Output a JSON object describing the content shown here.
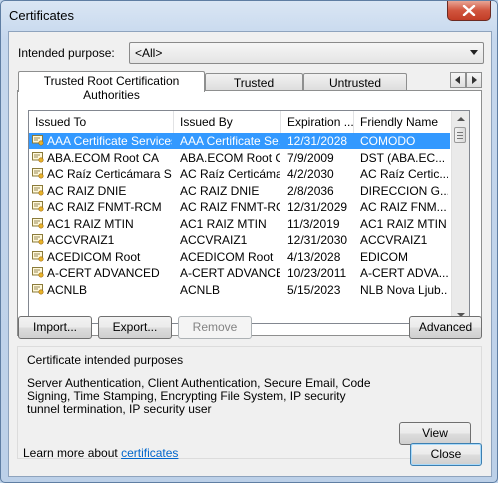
{
  "window": {
    "title": "Certificates"
  },
  "purpose": {
    "label": "Intended purpose:",
    "value": "<All>"
  },
  "tabs": [
    {
      "label": "Trusted Root Certification Authorities",
      "active": true
    },
    {
      "label": "Trusted Publishers",
      "active": false
    },
    {
      "label": "Untrusted Publishers",
      "active": false
    }
  ],
  "columns": [
    "Issued To",
    "Issued By",
    "Expiration ...",
    "Friendly Name"
  ],
  "rows": [
    {
      "issued_to": "AAA Certificate Services",
      "issued_by": "AAA Certificate Se...",
      "expiration": "12/31/2028",
      "friendly": "COMODO",
      "selected": true
    },
    {
      "issued_to": "ABA.ECOM Root CA",
      "issued_by": "ABA.ECOM Root CA",
      "expiration": "7/9/2009",
      "friendly": "DST (ABA.EC..."
    },
    {
      "issued_to": "AC Raíz Certicámara S.A.",
      "issued_by": "AC Raíz Certicáma...",
      "expiration": "4/2/2030",
      "friendly": "AC Raíz Certic..."
    },
    {
      "issued_to": "AC RAIZ DNIE",
      "issued_by": "AC RAIZ DNIE",
      "expiration": "2/8/2036",
      "friendly": "DIRECCION G..."
    },
    {
      "issued_to": "AC RAIZ FNMT-RCM",
      "issued_by": "AC RAIZ FNMT-RCM",
      "expiration": "12/31/2029",
      "friendly": "AC RAIZ FNM..."
    },
    {
      "issued_to": "AC1 RAIZ MTIN",
      "issued_by": "AC1 RAIZ MTIN",
      "expiration": "11/3/2019",
      "friendly": "AC1 RAIZ MTIN"
    },
    {
      "issued_to": "ACCVRAIZ1",
      "issued_by": "ACCVRAIZ1",
      "expiration": "12/31/2030",
      "friendly": "ACCVRAIZ1"
    },
    {
      "issued_to": "ACEDICOM Root",
      "issued_by": "ACEDICOM Root",
      "expiration": "4/13/2028",
      "friendly": "EDICOM"
    },
    {
      "issued_to": "A-CERT ADVANCED",
      "issued_by": "A-CERT ADVANCED",
      "expiration": "10/23/2011",
      "friendly": "A-CERT ADVA..."
    },
    {
      "issued_to": "ACNLB",
      "issued_by": "ACNLB",
      "expiration": "5/15/2023",
      "friendly": "NLB Nova Ljub..."
    }
  ],
  "buttons": {
    "import": "Import...",
    "export": "Export...",
    "remove": "Remove",
    "advanced": "Advanced",
    "view": "View",
    "close": "Close"
  },
  "purposes": {
    "heading": "Certificate intended purposes",
    "text": "Server Authentication, Client Authentication, Secure Email, Code Signing, Time Stamping, Encrypting File System, IP security tunnel termination, IP security user"
  },
  "footer": {
    "prefix": "Learn more about ",
    "link": "certificates"
  },
  "colors": {
    "selection": "#3399ff",
    "link": "#0066cc",
    "close_button": "#c23d26"
  },
  "icons": {
    "close": "close-icon",
    "certificate": "certificate-icon",
    "scroll_left": "chevron-left-icon",
    "scroll_right": "chevron-right-icon",
    "dropdown": "chevron-down-icon"
  }
}
